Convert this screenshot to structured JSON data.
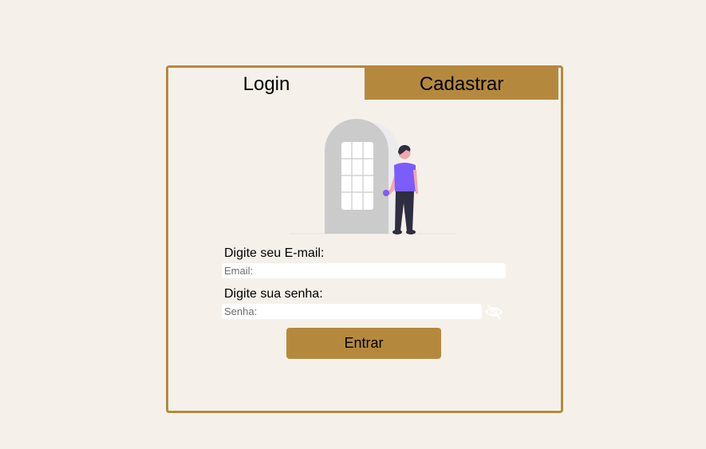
{
  "tabs": {
    "login_label": "Login",
    "register_label": "Cadastrar"
  },
  "form": {
    "email_label": "Digite seu E-mail:",
    "email_placeholder": "Email:",
    "email_value": "",
    "password_label": "Digite sua senha:",
    "password_placeholder": "Senha:",
    "password_value": "",
    "toggle_icon": "eye-slash-icon",
    "submit_label": "Entrar"
  },
  "colors": {
    "accent": "#b5893d",
    "background": "#f5f1ea",
    "illustration_purple": "#7b5cff"
  }
}
